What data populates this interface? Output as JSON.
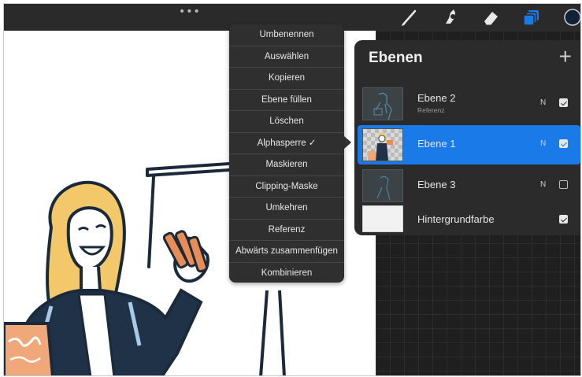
{
  "toolbar": {
    "more_dots": "•••",
    "tools": [
      "brush-icon",
      "smudge-icon",
      "eraser-icon",
      "layers-icon",
      "color-icon"
    ],
    "accent": "#1a7ae8"
  },
  "context_menu": {
    "items": [
      "Umbenennen",
      "Auswählen",
      "Kopieren",
      "Ebene füllen",
      "Löschen",
      "Alphasperre ✓",
      "Maskieren",
      "Clipping-Maske",
      "Umkehren",
      "Referenz",
      "Abwärts zusammenfügen",
      "Kombinieren"
    ]
  },
  "layers_panel": {
    "title": "Ebenen",
    "add_symbol": "+",
    "layers": [
      {
        "name": "Ebene 2",
        "sub": "Referenz",
        "mode": "N",
        "visible": true,
        "selected": false
      },
      {
        "name": "Ebene 1",
        "sub": "",
        "mode": "N",
        "visible": true,
        "selected": true
      },
      {
        "name": "Ebene 3",
        "sub": "",
        "mode": "N",
        "visible": false,
        "selected": false
      },
      {
        "name": "Hintergrundfarbe",
        "sub": "",
        "mode": "",
        "visible": true,
        "selected": false
      }
    ]
  }
}
